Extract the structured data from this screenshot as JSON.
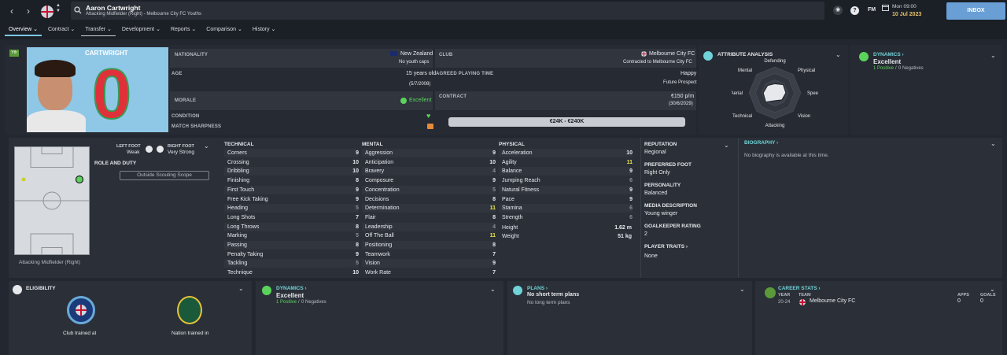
{
  "header": {
    "player_name": "Aaron Cartwright",
    "subtitle": "Attacking Midfielder (Right) - Melbourne City FC Youths",
    "date_time": "Mon 09:00",
    "date": "10 Jul 2023",
    "inbox_label": "INBOX",
    "fm_label": "FM"
  },
  "tabs": [
    {
      "label": "Overview ⌄"
    },
    {
      "label": "Contract ⌄"
    },
    {
      "label": "Transfer ⌄"
    },
    {
      "label": "Development ⌄"
    },
    {
      "label": "Reports ⌄"
    },
    {
      "label": "Comparison ⌄"
    },
    {
      "label": "History ⌄"
    }
  ],
  "card": {
    "name": "CARTWRIGHT",
    "number": "0",
    "yth_badge": "Yth"
  },
  "info": {
    "nationality_label": "NATIONALITY",
    "nationality": "New Zealand",
    "youth_caps": "No youth caps",
    "club_label": "CLUB",
    "club": "Melbourne City FC",
    "club_contract": "Contracted to Melbourne City FC",
    "age_label": "AGE",
    "age": "15 years old",
    "dob": "(5/7/2008)",
    "playing_time_label": "AGREED PLAYING TIME",
    "playing_time": "Happy",
    "playing_time_sub": "Future Prospect",
    "morale_label": "MORALE",
    "morale": "Excellent",
    "contract_label": "CONTRACT",
    "contract": "€150 p/m",
    "contract_end": "(30/6/2029)",
    "condition_label": "CONDITION",
    "match_sharpness_label": "MATCH SHARPNESS",
    "value_range": "€24K - €240K"
  },
  "attribute_analysis": {
    "title": "ATTRIBUTE ANALYSIS",
    "labels": [
      "Defending",
      "Physical",
      "Speed",
      "Vision",
      "Attacking",
      "Technical",
      "Aerial",
      "Mental"
    ],
    "values": [
      0.35,
      0.45,
      0.42,
      0.38,
      0.3,
      0.5,
      0.45,
      0.4
    ]
  },
  "dynamics_top": {
    "title": "DYNAMICS ›",
    "value": "Excellent",
    "positive": "1 Positive",
    "separator": "/",
    "negative": "0 Negatives"
  },
  "feet": {
    "left_label": "LEFT FOOT",
    "left_value": "Weak",
    "right_label": "RIGHT FOOT",
    "right_value": "Very Strong"
  },
  "role": {
    "label": "ROLE AND DUTY",
    "button": "Outside Scouting Scope"
  },
  "position_label": "Attacking Midfielder (Right)",
  "technical": {
    "title": "TECHNICAL",
    "items": [
      {
        "name": "Corners",
        "value": "9"
      },
      {
        "name": "Crossing",
        "value": "10"
      },
      {
        "name": "Dribbling",
        "value": "10"
      },
      {
        "name": "Finishing",
        "value": "8"
      },
      {
        "name": "First Touch",
        "value": "9"
      },
      {
        "name": "Free Kick Taking",
        "value": "9"
      },
      {
        "name": "Heading",
        "value": "5"
      },
      {
        "name": "Long Shots",
        "value": "7"
      },
      {
        "name": "Long Throws",
        "value": "8"
      },
      {
        "name": "Marking",
        "value": "5"
      },
      {
        "name": "Passing",
        "value": "8"
      },
      {
        "name": "Penalty Taking",
        "value": "9"
      },
      {
        "name": "Tackling",
        "value": "5"
      },
      {
        "name": "Technique",
        "value": "10"
      }
    ]
  },
  "mental": {
    "title": "MENTAL",
    "items": [
      {
        "name": "Aggression",
        "value": "9"
      },
      {
        "name": "Anticipation",
        "value": "10"
      },
      {
        "name": "Bravery",
        "value": "4"
      },
      {
        "name": "Composure",
        "value": "9"
      },
      {
        "name": "Concentration",
        "value": "5"
      },
      {
        "name": "Decisions",
        "value": "8"
      },
      {
        "name": "Determination",
        "value": "11"
      },
      {
        "name": "Flair",
        "value": "8"
      },
      {
        "name": "Leadership",
        "value": "4"
      },
      {
        "name": "Off The Ball",
        "value": "11"
      },
      {
        "name": "Positioning",
        "value": "8"
      },
      {
        "name": "Teamwork",
        "value": "7"
      },
      {
        "name": "Vision",
        "value": "9"
      },
      {
        "name": "Work Rate",
        "value": "7"
      }
    ]
  },
  "physical": {
    "title": "PHYSICAL",
    "items": [
      {
        "name": "Acceleration",
        "value": "10"
      },
      {
        "name": "Agility",
        "value": "11"
      },
      {
        "name": "Balance",
        "value": "9"
      },
      {
        "name": "Jumping Reach",
        "value": "6"
      },
      {
        "name": "Natural Fitness",
        "value": "9"
      },
      {
        "name": "Pace",
        "value": "9"
      },
      {
        "name": "Stamina",
        "value": "6"
      },
      {
        "name": "Strength",
        "value": "6"
      }
    ],
    "height_label": "Height",
    "height": "1.62 m",
    "weight_label": "Weight",
    "weight": "51 kg"
  },
  "profile": {
    "reputation_label": "REPUTATION",
    "reputation": "Regional",
    "foot_label": "PREFERRED FOOT",
    "foot": "Right Only",
    "personality_label": "PERSONALITY",
    "personality": "Balanced",
    "media_label": "MEDIA DESCRIPTION",
    "media": "Young winger",
    "gk_label": "GOALKEEPER RATING",
    "gk": "2",
    "traits_label": "PLAYER TRAITS ›",
    "traits": "None"
  },
  "biography": {
    "title": "BIOGRAPHY ›",
    "text": "No biography is available at this time."
  },
  "eligibility": {
    "title": "ELIGIBILITY",
    "club_trained": "Club trained at",
    "nation_trained": "Nation trained in"
  },
  "dynamics_bottom": {
    "title": "DYNAMICS ›",
    "value": "Excellent",
    "positive": "1 Positive",
    "separator": "/",
    "negative": "0 Negatives"
  },
  "plans": {
    "title": "PLANS ›",
    "short": "No short term plans",
    "long": "No long term plans"
  },
  "career": {
    "title": "CAREER STATS ›",
    "year_h": "YEAR",
    "team_h": "TEAM",
    "apps_h": "APPS",
    "goals_h": "GOALS",
    "year": "20-24",
    "team": "Melbourne City FC",
    "apps": "0",
    "goals": "0"
  },
  "colors": {
    "accent": "#7ec8e3",
    "link": "#6fd3d8",
    "card_bg": "#8fc7e6",
    "number_red": "#e0303a",
    "good_green": "#5bd35b"
  }
}
